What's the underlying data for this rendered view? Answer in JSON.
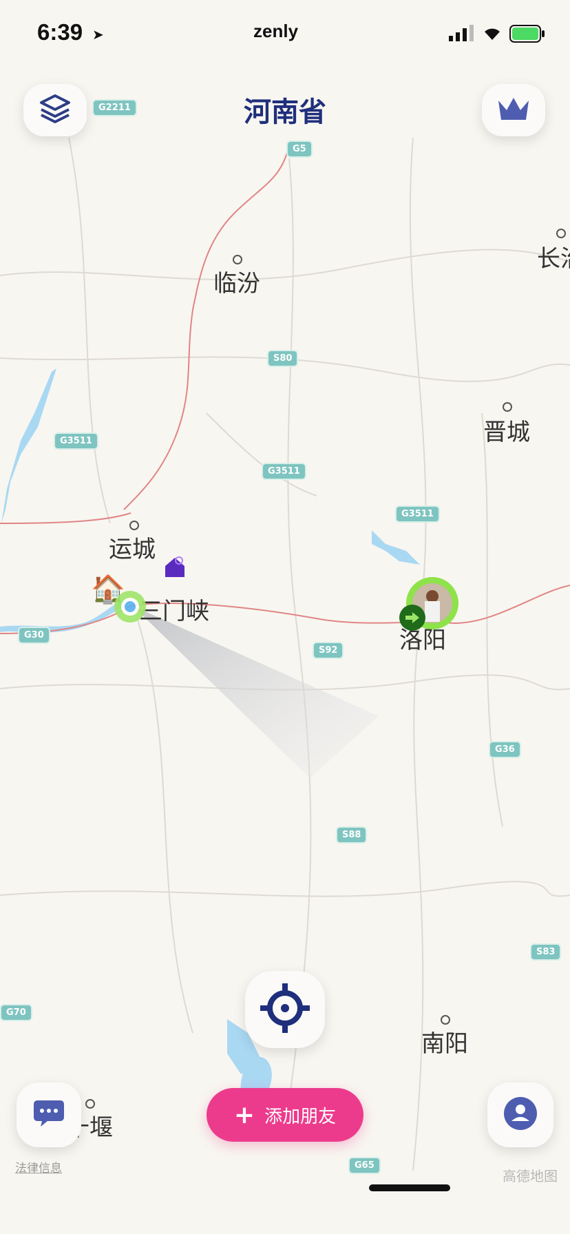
{
  "status_bar": {
    "time": "6:39",
    "carrier": "zenly"
  },
  "header": {
    "title": "河南省"
  },
  "cities": [
    {
      "name": "临汾"
    },
    {
      "name": "晋城"
    },
    {
      "name": "运城"
    },
    {
      "name": "三门峡"
    },
    {
      "name": "洛阳"
    },
    {
      "name": "南阳"
    },
    {
      "name": "长治"
    },
    {
      "name": "十堰"
    }
  ],
  "road_shields": [
    "G2211",
    "G5",
    "S80",
    "G3511",
    "G3511",
    "G3511",
    "G30",
    "S92",
    "G36",
    "S88",
    "S83",
    "G70",
    "G65"
  ],
  "buttons": {
    "add_friend": "添加朋友"
  },
  "footer": {
    "legal": "法律信息",
    "attribution": "高德地图"
  },
  "colors": {
    "accent": "#ec3b8c",
    "brand": "#1f2f7c",
    "road": "#e08585",
    "water": "#a9d8f3"
  }
}
